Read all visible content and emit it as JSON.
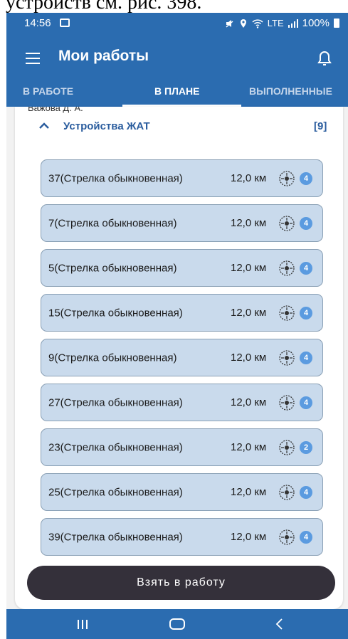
{
  "caption": "устройств см. рис. 398.",
  "status_bar": {
    "time": "14:56",
    "network": "LTE",
    "battery": "100%"
  },
  "app_bar": {
    "title": "Мои работы"
  },
  "tabs": [
    {
      "label": "В РАБОТЕ",
      "active": false
    },
    {
      "label": "В ПЛАНЕ",
      "active": true
    },
    {
      "label": "ВЫПОЛНЕННЫЕ",
      "active": false
    }
  ],
  "assignee": "Важова Д. А.",
  "group": {
    "title": "Устройства ЖАТ",
    "count": "[9]"
  },
  "items": [
    {
      "name": "37(Стрелка обыкновенная)",
      "distance": "12,0 км",
      "badge": "4"
    },
    {
      "name": "7(Стрелка обыкновенная)",
      "distance": "12,0 км",
      "badge": "4"
    },
    {
      "name": "5(Стрелка обыкновенная)",
      "distance": "12,0 км",
      "badge": "4"
    },
    {
      "name": "15(Стрелка обыкновенная)",
      "distance": "12,0 км",
      "badge": "4"
    },
    {
      "name": "9(Стрелка обыкновенная)",
      "distance": "12,0 км",
      "badge": "4"
    },
    {
      "name": "27(Стрелка обыкновенная)",
      "distance": "12,0 км",
      "badge": "4"
    },
    {
      "name": "23(Стрелка обыкновенная)",
      "distance": "12,0 км",
      "badge": "2"
    },
    {
      "name": "25(Стрелка обыкновенная)",
      "distance": "12,0 км",
      "badge": "4"
    },
    {
      "name": "39(Стрелка обыкновенная)",
      "distance": "12,0 км",
      "badge": "4"
    }
  ],
  "actions": {
    "take_label": "Взять в работу"
  },
  "icons": {
    "menu": "menu-icon",
    "bell": "bell-icon",
    "chevron": "chevron-up-icon",
    "target": "target-icon",
    "nav_recent": "recent-apps-icon",
    "nav_home": "home-icon",
    "nav_back": "back-icon"
  },
  "colors": {
    "primary": "#2b6cb0",
    "item_bg": "#c9daec",
    "badge": "#5b9be0",
    "button": "#34303a",
    "group_title": "#2b5d9e"
  }
}
